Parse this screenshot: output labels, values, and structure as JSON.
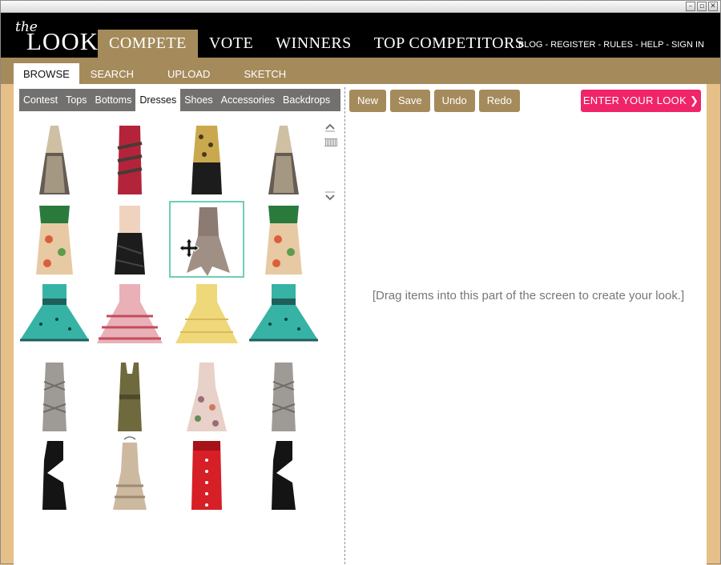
{
  "window": {
    "controls": [
      "–",
      "▫",
      "✕"
    ]
  },
  "header": {
    "logo_the": "the",
    "logo_look": "LOOK",
    "nav": [
      {
        "label": "COMPETE",
        "active": true
      },
      {
        "label": "VOTE"
      },
      {
        "label": "WINNERS"
      },
      {
        "label": "TOP COMPETITORS"
      }
    ],
    "toplinks": "BLOG - REGISTER - RULES - HELP - SIGN IN"
  },
  "subtabs": [
    {
      "label": "BROWSE",
      "active": true
    },
    {
      "label": "SEARCH"
    },
    {
      "label": "UPLOAD"
    },
    {
      "label": "SKETCH"
    }
  ],
  "browse": {
    "categories": [
      {
        "label": "Contest"
      },
      {
        "label": "Tops"
      },
      {
        "label": "Bottoms"
      },
      {
        "label": "Dresses",
        "active": true
      },
      {
        "label": "Shoes"
      },
      {
        "label": "Accessories"
      },
      {
        "label": "Backdrops"
      }
    ],
    "dresses": [
      {
        "icon": "halter-sheer-dress",
        "colors": [
          "#cfc0a3",
          "#4a4035"
        ]
      },
      {
        "icon": "red-bandage-dress",
        "colors": [
          "#b3243a",
          "#4a3a36"
        ]
      },
      {
        "icon": "leopard-top-black-dress",
        "colors": [
          "#caa94e",
          "#1c1c1c"
        ]
      },
      {
        "icon": "halter-sheer-dress",
        "colors": [
          "#cfc0a3",
          "#4a4035"
        ]
      },
      {
        "icon": "floral-strapless-dress",
        "colors": [
          "#2a7a3c",
          "#e7c9a3"
        ]
      },
      {
        "icon": "peach-black-draped-dress",
        "colors": [
          "#f0d3bf",
          "#1c1c1c"
        ]
      },
      {
        "icon": "grey-ruffle-dress",
        "colors": [
          "#8c7b72",
          "#a08f84"
        ],
        "selected": true
      },
      {
        "icon": "floral-strapless-dress",
        "colors": [
          "#2a7a3c",
          "#e7c9a3"
        ]
      },
      {
        "icon": "teal-polka-ball-dress",
        "colors": [
          "#36b3a5",
          "#1f5f5a"
        ]
      },
      {
        "icon": "pink-ruffle-ball-dress",
        "colors": [
          "#e9b0b7",
          "#c24c5e"
        ]
      },
      {
        "icon": "yellow-tiered-dress",
        "colors": [
          "#efd87a",
          "#d9b95a"
        ]
      },
      {
        "icon": "teal-polka-ball-dress",
        "colors": [
          "#36b3a5",
          "#1f5f5a"
        ]
      },
      {
        "icon": "grey-bandage-dress",
        "colors": [
          "#9e9b97",
          "#6e6b68"
        ]
      },
      {
        "icon": "olive-pinafore-dress",
        "colors": [
          "#6e6a3e",
          "#4f4b2a"
        ]
      },
      {
        "icon": "floral-sundress",
        "colors": [
          "#e8d1c8",
          "#9a6b7a"
        ]
      },
      {
        "icon": "grey-bandage-dress",
        "colors": [
          "#9e9b97",
          "#6e6b68"
        ]
      },
      {
        "icon": "black-cutout-dress",
        "colors": [
          "#141414",
          "#2b2b2b"
        ]
      },
      {
        "icon": "beige-ruffle-hanger-dress",
        "colors": [
          "#cdb9a0",
          "#9e8a70"
        ]
      },
      {
        "icon": "red-button-dress",
        "colors": [
          "#d61f26",
          "#a51218"
        ]
      },
      {
        "icon": "black-cutout-dress",
        "colors": [
          "#141414",
          "#2b2b2b"
        ]
      }
    ]
  },
  "toolbar": {
    "buttons": [
      {
        "label": "New"
      },
      {
        "label": "Save"
      },
      {
        "label": "Undo"
      },
      {
        "label": "Redo"
      }
    ],
    "enter_label": "ENTER YOUR LOOK",
    "enter_icon": "❯"
  },
  "canvas_hint": "[Drag items into this part of the screen to create your look.]",
  "colors": {
    "accent": "#a58b5b",
    "pink": "#ef2469",
    "selection": "#6ecdb8",
    "frame": "#e6c088"
  }
}
